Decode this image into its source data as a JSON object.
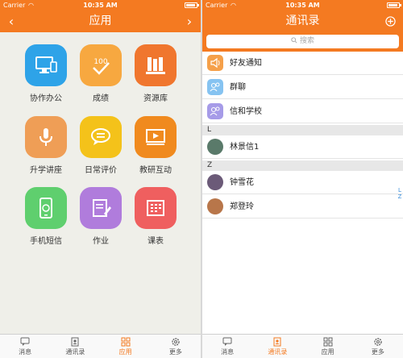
{
  "status": {
    "carrier": "Carrier",
    "time": "10:35 AM"
  },
  "apps_screen": {
    "title": "应用",
    "apps": [
      {
        "label": "协作办公",
        "icon": "monitor-icon",
        "color": "#2ea3e8"
      },
      {
        "label": "成绩",
        "icon": "score-icon",
        "color": "#f7a840"
      },
      {
        "label": "资源库",
        "icon": "books-icon",
        "color": "#f0762e"
      },
      {
        "label": "升学讲座",
        "icon": "microphone-icon",
        "color": "#ef9e56"
      },
      {
        "label": "日常评价",
        "icon": "chat-bubble-icon",
        "color": "#f4c21a"
      },
      {
        "label": "教研互动",
        "icon": "video-icon",
        "color": "#f08a1e"
      },
      {
        "label": "手机短信",
        "icon": "sms-phone-icon",
        "color": "#5fcf6e"
      },
      {
        "label": "作业",
        "icon": "notepad-icon",
        "color": "#b07cdc"
      },
      {
        "label": "课表",
        "icon": "calendar-icon",
        "color": "#ef5f5f"
      }
    ]
  },
  "contacts_screen": {
    "title": "通讯录",
    "search_placeholder": "搜索",
    "top_items": [
      {
        "name": "好友通知",
        "icon": "speaker-icon",
        "color": "#f5a04a"
      },
      {
        "name": "群聊",
        "icon": "group-icon",
        "color": "#86c3f1"
      },
      {
        "name": "信和学校",
        "icon": "school-icon",
        "color": "#a69be8"
      }
    ],
    "sections": [
      {
        "letter": "L",
        "contacts": [
          {
            "name": "林景信1",
            "avatar_color": "#5a7a6a"
          }
        ]
      },
      {
        "letter": "Z",
        "contacts": [
          {
            "name": "钟雪花",
            "avatar_color": "#6b5a78"
          },
          {
            "name": "郑登玲",
            "avatar_color": "#b8764a"
          }
        ]
      }
    ],
    "index_letters": [
      "L",
      "Z"
    ]
  },
  "tabbar": {
    "tabs": [
      {
        "label": "消息",
        "icon": "message-icon"
      },
      {
        "label": "通讯录",
        "icon": "contacts-icon"
      },
      {
        "label": "应用",
        "icon": "apps-grid-icon"
      },
      {
        "label": "更多",
        "icon": "gear-icon"
      }
    ]
  },
  "colors": {
    "accent": "#f47a21",
    "background": "#efefe9"
  }
}
